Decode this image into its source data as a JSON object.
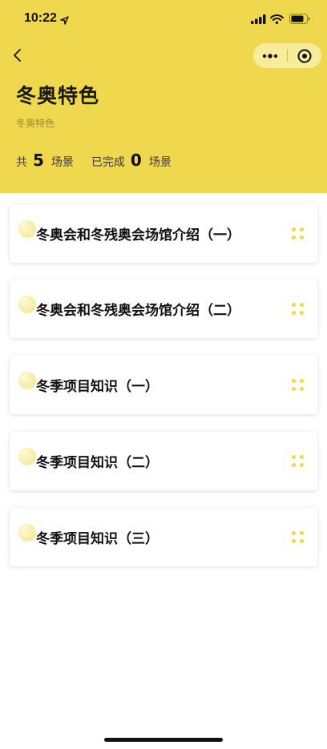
{
  "status_bar": {
    "time": "10:22",
    "icons": [
      "location-arrow-icon",
      "signal-icon",
      "wifi-icon",
      "battery-icon"
    ]
  },
  "nav": {
    "back_icon": "chevron-left-icon",
    "more_icon": "more-dots-icon",
    "close_icon": "target-circle-icon"
  },
  "header": {
    "title": "冬奥特色",
    "subtitle": "冬奥特色",
    "stats": {
      "total_prefix": "共",
      "total_count": "5",
      "total_unit": "场景",
      "done_prefix": "已完成",
      "done_count": "0",
      "done_unit": "场景"
    }
  },
  "scenes": [
    {
      "title": "冬奥会和冬残奥会场馆介绍（一）"
    },
    {
      "title": "冬奥会和冬残奥会场馆介绍（二）"
    },
    {
      "title": "冬季项目知识（一）"
    },
    {
      "title": "冬季项目知识（二）"
    },
    {
      "title": "冬季项目知识（三）"
    }
  ],
  "colors": {
    "accent": "#EFD84D",
    "card_bg": "#FFFFFF",
    "text": "#111111"
  }
}
